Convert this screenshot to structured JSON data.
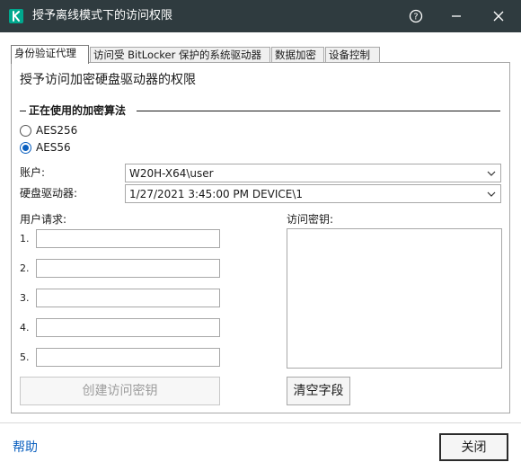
{
  "window": {
    "title": "授予离线模式下的访问权限",
    "help_symbol": "?",
    "logo_letter": "K"
  },
  "tabs": [
    {
      "label": "身份验证代理",
      "active": true
    },
    {
      "label": "访问受 BitLocker 保护的系统驱动器",
      "active": false
    },
    {
      "label": "数据加密",
      "active": false
    },
    {
      "label": "设备控制",
      "active": false
    }
  ],
  "panel": {
    "heading": "授予访问加密硬盘驱动器的权限",
    "algorithm_group": {
      "title": "正在使用的加密算法",
      "options": [
        {
          "label": "AES256",
          "checked": false
        },
        {
          "label": "AES56",
          "checked": true
        }
      ]
    },
    "account": {
      "label": "账户:",
      "value": "W20H-X64\\user"
    },
    "drive": {
      "label": "硬盘驱动器:",
      "value": "1/27/2021 3:45:00 PM  DEVICE\\1"
    },
    "user_request": {
      "label": "用户请求:",
      "rows": [
        {
          "num": "1.",
          "value": ""
        },
        {
          "num": "2.",
          "value": ""
        },
        {
          "num": "3.",
          "value": ""
        },
        {
          "num": "4.",
          "value": ""
        },
        {
          "num": "5.",
          "value": ""
        }
      ]
    },
    "access_key": {
      "label": "访问密钥:",
      "value": ""
    },
    "create_button": "创建访问密钥",
    "clear_button": "清空字段"
  },
  "footer": {
    "help": "帮助",
    "close": "关闭"
  },
  "colors": {
    "titlebar": "#2f3b3f",
    "logo": "#00a88e",
    "accent": "#0a5fbf"
  }
}
